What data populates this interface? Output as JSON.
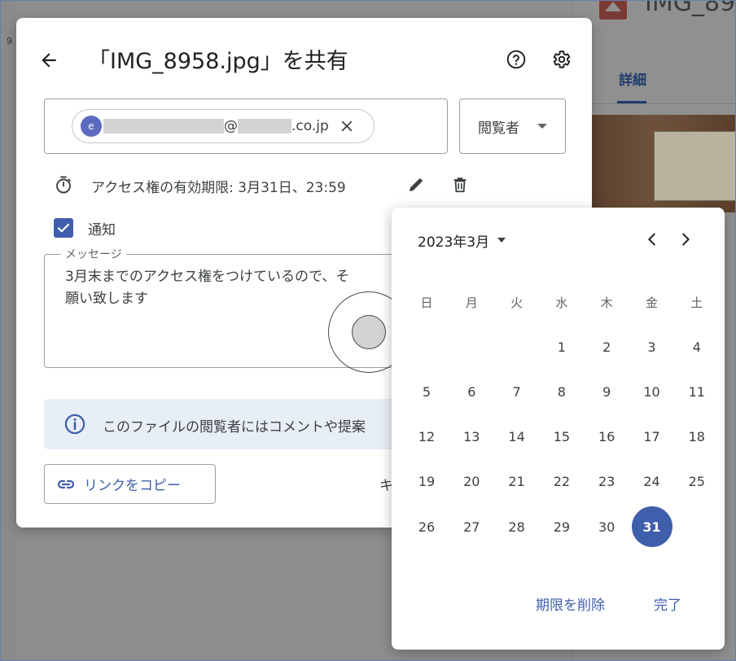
{
  "background": {
    "file_name": "IMG_89",
    "tab_details": "詳細",
    "left_number": "9"
  },
  "dialog": {
    "title": "「IMG_8958.jpg」を共有",
    "chip": {
      "avatar_letter": "e",
      "email_at": "@",
      "email_domain": ".co.jp"
    },
    "role": "閲覧者",
    "expiry": "アクセス権の有効期限: 3月31日、23:59",
    "notify_label": "通知",
    "notify_checked": true,
    "message_legend": "メッセージ",
    "message_text": "3月末までのアクセス権をつけているので、そ\n願い致します",
    "info_text": "このファイルの閲覧者にはコメントや提案",
    "copy_link": "リンクをコピー",
    "cancel": "キャンセル"
  },
  "datepicker": {
    "month_label": "2023年3月",
    "weekdays": [
      "日",
      "月",
      "火",
      "水",
      "木",
      "金",
      "土"
    ],
    "first_weekday_index": 3,
    "days_in_month": 31,
    "selected_day": 31,
    "clear_label": "期限を削除",
    "done_label": "完了"
  },
  "colors": {
    "accent": "#3f5eab",
    "info_bg": "#e8eef8",
    "text": "#3c4043"
  },
  "icons": {
    "back": "back-arrow-icon",
    "help": "help-icon",
    "settings": "gear-icon",
    "chip_close": "close-icon",
    "timer": "timer-icon",
    "edit": "pencil-icon",
    "delete": "trash-icon",
    "info": "info-icon",
    "link": "link-icon",
    "prev": "chevron-left-icon",
    "next": "chevron-right-icon"
  }
}
